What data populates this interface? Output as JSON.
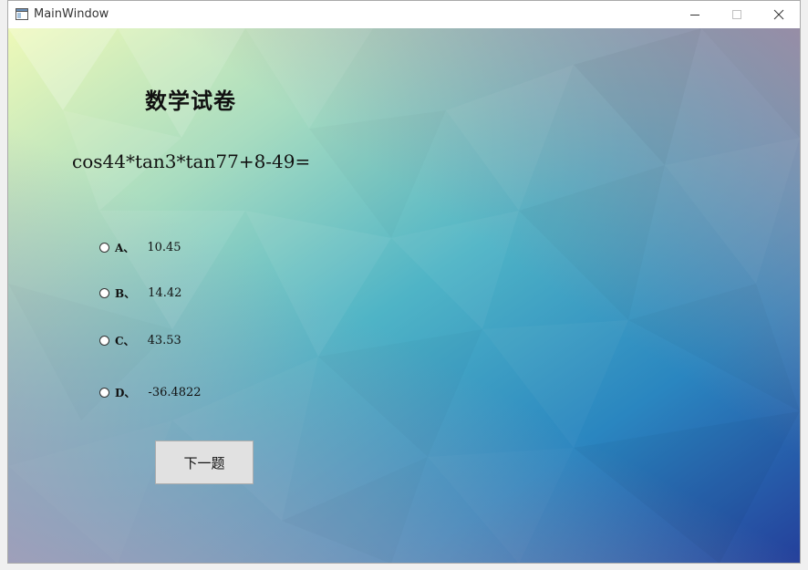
{
  "window": {
    "title": "MainWindow"
  },
  "paper": {
    "title": "数学试卷",
    "question": "cos44*tan3*tan77+8-49=",
    "options": [
      {
        "letter": "A、",
        "value": "10.45"
      },
      {
        "letter": "B、",
        "value": "14.42"
      },
      {
        "letter": "C、",
        "value": "43.53"
      },
      {
        "letter": "D、",
        "value": "-36.4822"
      }
    ],
    "next_label": "下一题"
  },
  "colors": {
    "bg_top_left": "#e8f5b5",
    "bg_mid": "#4fb3c4",
    "bg_bottom_right": "#2d4a9e",
    "button_face": "#e1e1e1"
  }
}
